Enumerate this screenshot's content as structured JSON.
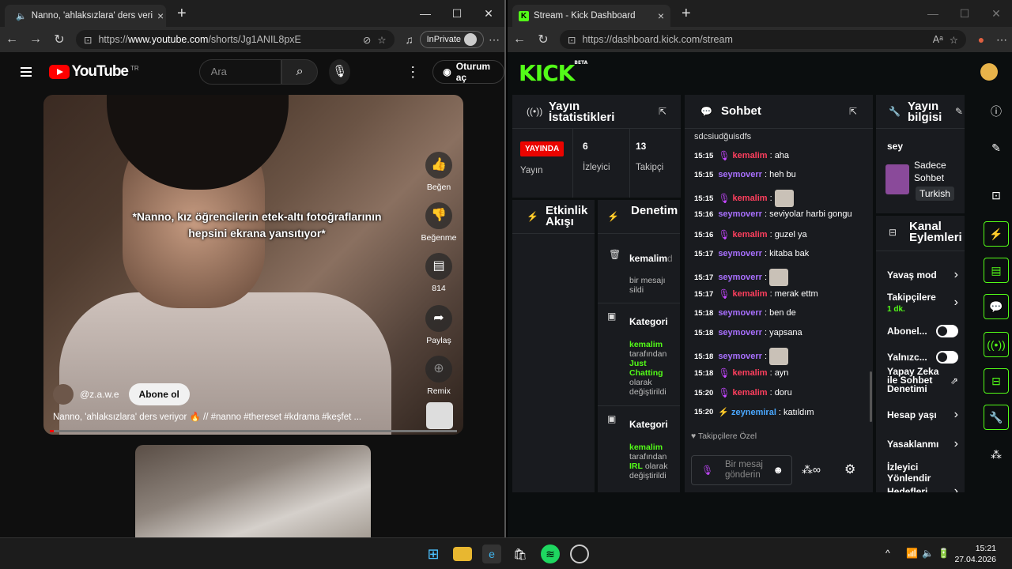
{
  "left_browser": {
    "tab_title": "Nanno, 'ahlaksızlara' ders veri",
    "url_prefix": "https://",
    "url_domain": "www.youtube.com",
    "url_path": "/shorts/Jg1ANIL8pxE",
    "inprivate_label": "InPrivate"
  },
  "youtube": {
    "logo_text": "YouTube",
    "region": "TR",
    "search_placeholder": "Ara",
    "signin_label": "Oturum aç",
    "caption": "*Nanno, kız öğrencilerin etek-altı fotoğraflarının hepsini ekrana yansıtıyor*",
    "like_label": "Beğen",
    "dislike_label": "Beğenme",
    "comment_count": "814",
    "share_label": "Paylaş",
    "remix_label": "Remix",
    "channel": "@z.a.w.e",
    "subscribe_label": "Abone ol",
    "description": "Nanno, 'ahlaksızlara' ders veriyor 🔥 // #nanno #thereset #kdrama #keşfet ...",
    "progress_fraction": 0.01
  },
  "right_browser": {
    "tab_title": "Stream - Kick Dashboard",
    "url_prefix": "https://",
    "url_domain": "dashboard.kick.com",
    "url_path": "/stream"
  },
  "kick": {
    "logo": "KICK",
    "beta": "BETA",
    "stats_title": "Yayın İstatistikleri",
    "live_badge": "YAYINDA",
    "live_label": "Yayın",
    "viewers_value": "6",
    "viewers_label": "İzleyici",
    "followers_value": "13",
    "followers_label": "Takipçi",
    "activity_title": "Etkinlik Akışı",
    "mod_title": "Denetim Eylemleri",
    "mod_events": [
      {
        "user": "kemalim",
        "suffix": "d",
        "text": "bir mesajı sildi"
      },
      {
        "title": "Kategori",
        "user": "kemalim",
        "by": "tarafından",
        "cat": "Just Chatting",
        "tail": "olarak değiştirildi"
      },
      {
        "title": "Kategori",
        "user": "kemalim",
        "by": "tarafından",
        "cat": "IRL",
        "tail": "olarak değiştirildi"
      }
    ],
    "chat_title": "Sohbet",
    "chat_top": "sdcsiudğuisdfs",
    "chat": [
      {
        "time": "15:15",
        "user": "kemalim",
        "cls": "u1",
        "badge": true,
        "text": ": aha"
      },
      {
        "time": "15:15",
        "user": "seymoverr",
        "cls": "u2",
        "badge": false,
        "text": ": heh bu"
      },
      {
        "time": "15:15",
        "user": "kemalim",
        "cls": "u1",
        "badge": true,
        "text": ":",
        "emote": true
      },
      {
        "time": "15:16",
        "user": "seymoverr",
        "cls": "u2",
        "badge": false,
        "text": ": seviyolar harbi gongu"
      },
      {
        "time": "15:16",
        "user": "kemalim",
        "cls": "u1",
        "badge": true,
        "text": ": guzel ya"
      },
      {
        "time": "15:17",
        "user": "seymoverr",
        "cls": "u2",
        "badge": false,
        "text": ": kitaba bak"
      },
      {
        "time": "15:17",
        "user": "seymoverr",
        "cls": "u2",
        "badge": false,
        "text": ":",
        "emote": true
      },
      {
        "time": "15:17",
        "user": "kemalim",
        "cls": "u1",
        "badge": true,
        "text": ": merak ettm"
      },
      {
        "time": "15:18",
        "user": "seymoverr",
        "cls": "u2",
        "badge": false,
        "text": ": ben de"
      },
      {
        "time": "15:18",
        "user": "seymoverr",
        "cls": "u2",
        "badge": false,
        "text": ": yapsana"
      },
      {
        "time": "15:18",
        "user": "seymoverr",
        "cls": "u2",
        "badge": false,
        "text": ":",
        "emote": true
      },
      {
        "time": "15:18",
        "user": "kemalim",
        "cls": "u1",
        "badge": true,
        "text": ": ayn"
      },
      {
        "time": "15:20",
        "user": "kemalim",
        "cls": "u1",
        "badge": true,
        "text": ": doru"
      },
      {
        "time": "15:20",
        "user": "zeynemiral",
        "cls": "u3",
        "badge": false,
        "text": ": katıldım"
      }
    ],
    "followers_only": "Takipçilere Özel",
    "chat_placeholder": "Bir mesaj gönderin",
    "info_title": "Yayın bilgisi",
    "stream_title": "sey",
    "category": "Sadece Sohbet",
    "language": "Turkish",
    "channel_actions_title": "Kanal Eylemleri",
    "actions": [
      {
        "label": "Yavaş mod",
        "type": "chev"
      },
      {
        "label": "Takipçilere",
        "sub": "1 dk.",
        "type": "chev"
      },
      {
        "label": "Abonel...",
        "type": "toggle"
      },
      {
        "label": "Yalnızc...",
        "type": "toggle"
      },
      {
        "label": "Yapay Zeka ile Sohbet Denetimi",
        "type": "ext"
      },
      {
        "label": "Hesap yaşı",
        "type": "chev"
      },
      {
        "label": "Yasaklanmı",
        "type": "chev"
      },
      {
        "label": "İzleyici Yönlendir",
        "type": "none"
      },
      {
        "label": "Hedefleri",
        "type": "chev"
      }
    ]
  },
  "taskbar": {
    "time": "15:21",
    "date": "27.04.2026"
  }
}
